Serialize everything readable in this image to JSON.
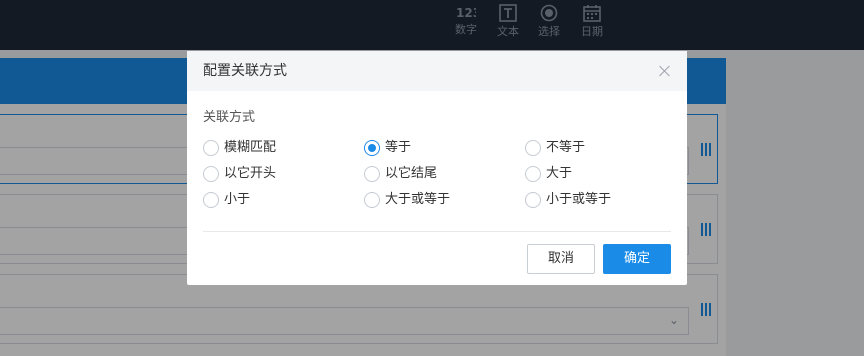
{
  "toolbar": {
    "tools": [
      {
        "label": "数字",
        "icon": "number-icon"
      },
      {
        "label": "文本",
        "icon": "text-icon"
      },
      {
        "label": "选择",
        "icon": "radio-select-icon"
      },
      {
        "label": "日期",
        "icon": "calendar-icon"
      }
    ]
  },
  "dialog": {
    "title": "配置关联方式",
    "section_label": "关联方式",
    "options": [
      {
        "label": "模糊匹配",
        "checked": false
      },
      {
        "label": "等于",
        "checked": true
      },
      {
        "label": "不等于",
        "checked": false
      },
      {
        "label": "以它开头",
        "checked": false
      },
      {
        "label": "以它结尾",
        "checked": false
      },
      {
        "label": "大于",
        "checked": false
      },
      {
        "label": "小于",
        "checked": false
      },
      {
        "label": "大于或等于",
        "checked": false
      },
      {
        "label": "小于或等于",
        "checked": false
      }
    ],
    "selected": "等于",
    "cancel_label": "取消",
    "confirm_label": "确定"
  },
  "colors": {
    "accent": "#1a8ce8",
    "topbar": "#1e2a38",
    "overlay": "rgba(0,0,0,0.36)"
  }
}
